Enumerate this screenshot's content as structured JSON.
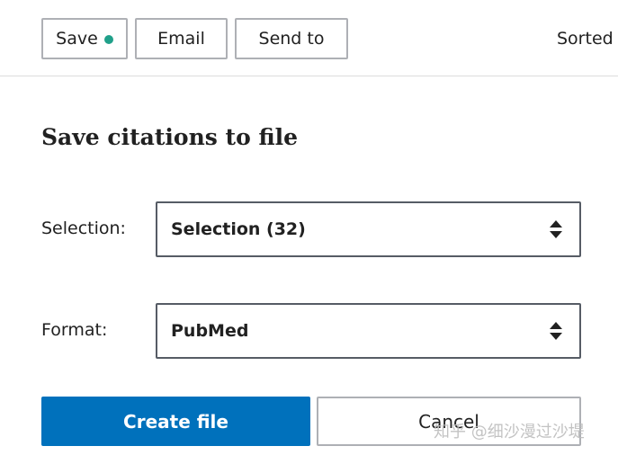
{
  "toolbar": {
    "save_label": "Save",
    "email_label": "Email",
    "send_to_label": "Send to",
    "sorted_label": "Sorted",
    "save_indicator_color": "#20a08a"
  },
  "panel": {
    "title": "Save citations to file",
    "selection": {
      "label": "Selection:",
      "value": "Selection (32)"
    },
    "format": {
      "label": "Format:",
      "value": "PubMed"
    },
    "create_button": "Create file",
    "cancel_button": "Cancel"
  },
  "watermark": "知乎 @细沙漫过沙堤",
  "colors": {
    "primary": "#0071bc",
    "border": "#aeb0b5",
    "select_border": "#565c65",
    "text": "#212121"
  },
  "icons": {
    "select_arrows": "up-down-arrows-icon"
  }
}
